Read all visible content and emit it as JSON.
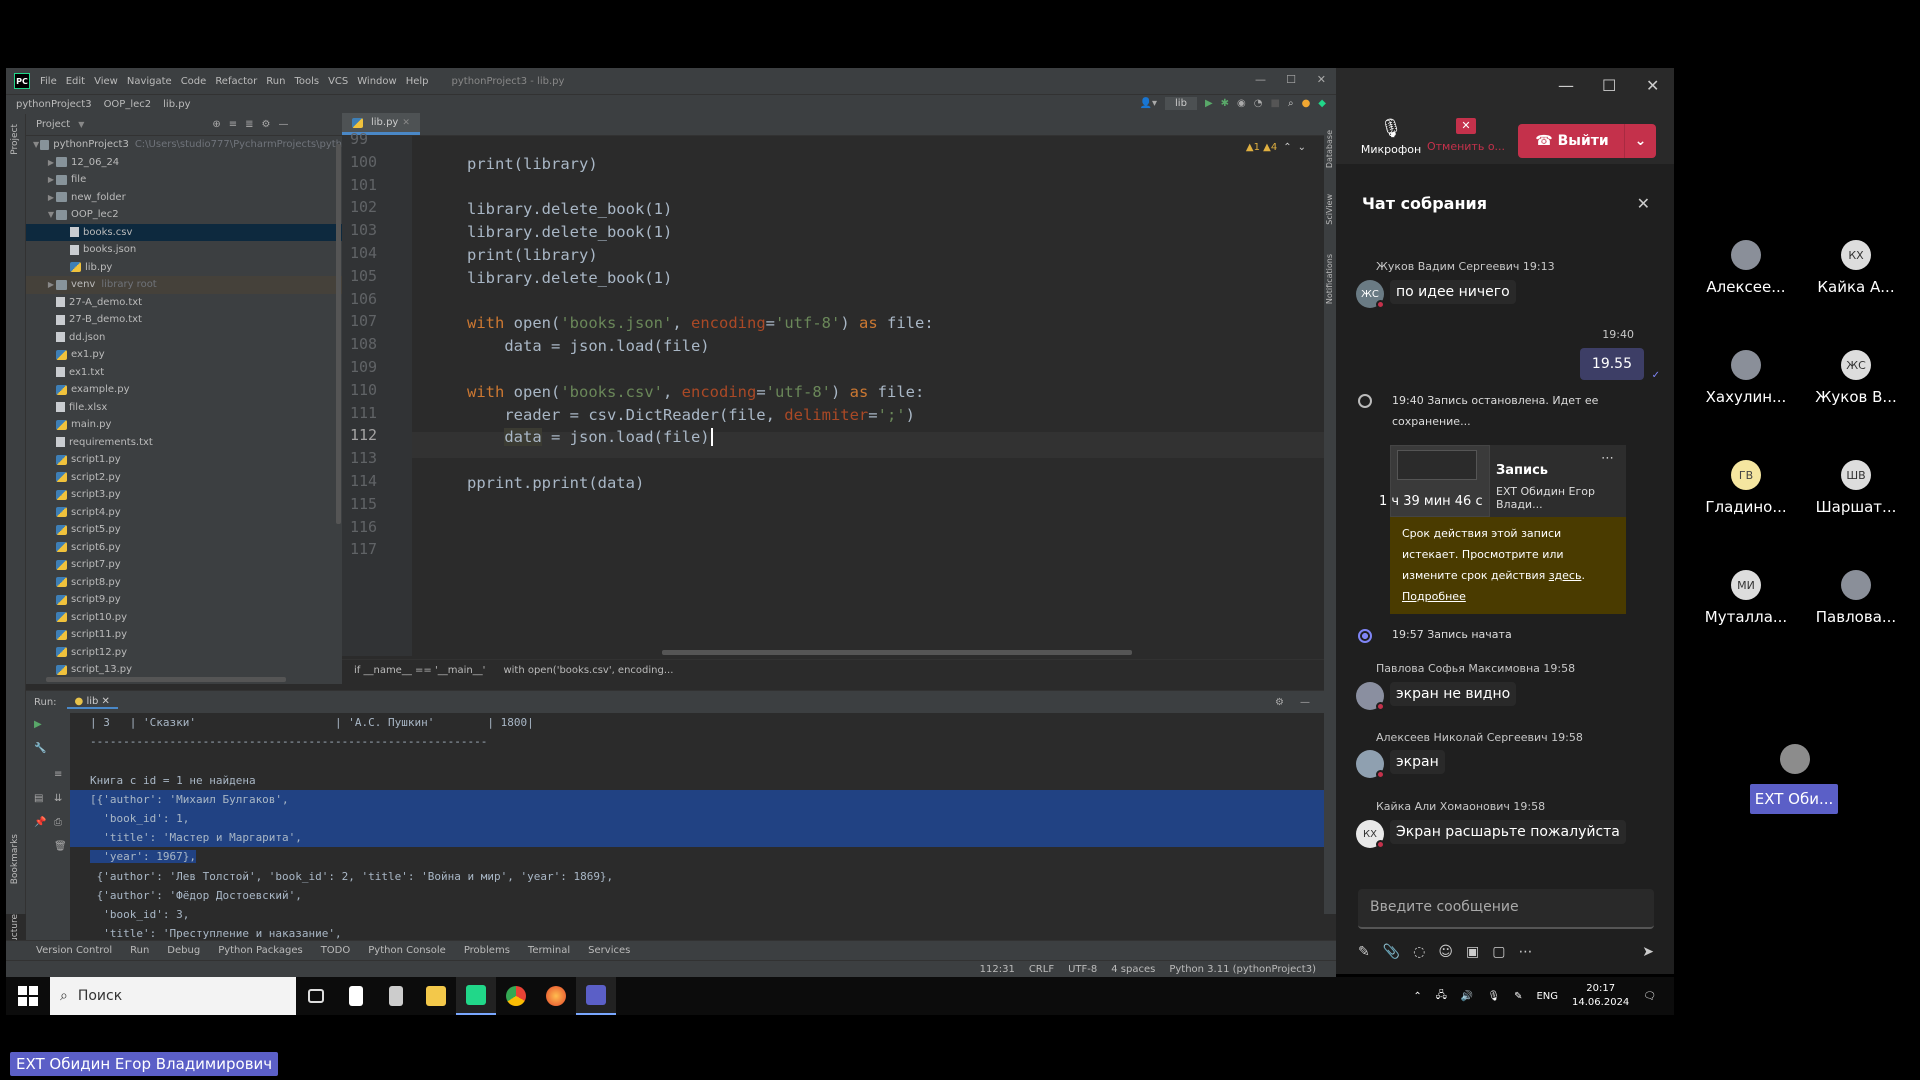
{
  "ide": {
    "logo": "PC",
    "menu": [
      "File",
      "Edit",
      "View",
      "Navigate",
      "Code",
      "Refactor",
      "Run",
      "Tools",
      "VCS",
      "Window",
      "Help"
    ],
    "window_title": "pythonProject3 - lib.py",
    "breadcrumbs": [
      "pythonProject3",
      "OOP_lec2",
      "lib.py"
    ],
    "run_config": "lib",
    "project_label": "Project",
    "tree": [
      {
        "name": "pythonProject3",
        "hint": "C:\\Users\\studio777\\PycharmProjects\\pyth",
        "type": "folder",
        "depth": 0,
        "open": true
      },
      {
        "name": "12_06_24",
        "type": "folder",
        "depth": 1
      },
      {
        "name": "file",
        "type": "folder",
        "depth": 1
      },
      {
        "name": "new_folder",
        "type": "folder",
        "depth": 1
      },
      {
        "name": "OOP_lec2",
        "type": "folder",
        "depth": 1,
        "open": true
      },
      {
        "name": "books.csv",
        "type": "txt",
        "depth": 2,
        "selected": true
      },
      {
        "name": "books.json",
        "type": "txt",
        "depth": 2
      },
      {
        "name": "lib.py",
        "type": "py",
        "depth": 2
      },
      {
        "name": "venv",
        "hint": "library root",
        "type": "folder",
        "depth": 1,
        "venv": true
      },
      {
        "name": "27-A_demo.txt",
        "type": "txt",
        "depth": 1
      },
      {
        "name": "27-B_demo.txt",
        "type": "txt",
        "depth": 1
      },
      {
        "name": "dd.json",
        "type": "txt",
        "depth": 1
      },
      {
        "name": "ex1.py",
        "type": "py",
        "depth": 1
      },
      {
        "name": "ex1.txt",
        "type": "txt",
        "depth": 1
      },
      {
        "name": "example.py",
        "type": "py",
        "depth": 1
      },
      {
        "name": "file.xlsx",
        "type": "txt",
        "depth": 1
      },
      {
        "name": "main.py",
        "type": "py",
        "depth": 1
      },
      {
        "name": "requirements.txt",
        "type": "txt",
        "depth": 1
      },
      {
        "name": "script1.py",
        "type": "py",
        "depth": 1
      },
      {
        "name": "script2.py",
        "type": "py",
        "depth": 1
      },
      {
        "name": "script3.py",
        "type": "py",
        "depth": 1
      },
      {
        "name": "script4.py",
        "type": "py",
        "depth": 1
      },
      {
        "name": "script5.py",
        "type": "py",
        "depth": 1
      },
      {
        "name": "script6.py",
        "type": "py",
        "depth": 1
      },
      {
        "name": "script7.py",
        "type": "py",
        "depth": 1
      },
      {
        "name": "script8.py",
        "type": "py",
        "depth": 1
      },
      {
        "name": "script9.py",
        "type": "py",
        "depth": 1
      },
      {
        "name": "script10.py",
        "type": "py",
        "depth": 1
      },
      {
        "name": "script11.py",
        "type": "py",
        "depth": 1
      },
      {
        "name": "script12.py",
        "type": "py",
        "depth": 1
      },
      {
        "name": "script_13.py",
        "type": "py",
        "depth": 1
      }
    ],
    "editor_tab": "lib.py",
    "warnings": "▲1  ▲4",
    "lines": [
      {
        "n": "99",
        "code": []
      },
      {
        "n": "100",
        "code": [
          [
            "t",
            "print(library)"
          ]
        ]
      },
      {
        "n": "101",
        "code": []
      },
      {
        "n": "102",
        "code": [
          [
            "t",
            "library.delete_book(1)"
          ]
        ]
      },
      {
        "n": "103",
        "code": [
          [
            "t",
            "library.delete_book(1)"
          ]
        ]
      },
      {
        "n": "104",
        "code": [
          [
            "t",
            "print(library)"
          ]
        ]
      },
      {
        "n": "105",
        "code": [
          [
            "t",
            "library.delete_book(1)"
          ]
        ]
      },
      {
        "n": "106",
        "code": []
      },
      {
        "n": "107",
        "code": [
          [
            "kw",
            "with "
          ],
          [
            "t",
            "open("
          ],
          [
            "str",
            "'books.json'"
          ],
          [
            "t",
            ", "
          ],
          [
            "prm",
            "encoding"
          ],
          [
            "t",
            "="
          ],
          [
            "str",
            "'utf-8'"
          ],
          [
            "t",
            ") "
          ],
          [
            "kw",
            "as "
          ],
          [
            "t",
            "file:"
          ]
        ]
      },
      {
        "n": "108",
        "code": [
          [
            "t",
            "    data = json.load(file)"
          ]
        ]
      },
      {
        "n": "109",
        "code": []
      },
      {
        "n": "110",
        "code": [
          [
            "kw",
            "with "
          ],
          [
            "t",
            "open("
          ],
          [
            "str",
            "'books.csv'"
          ],
          [
            "t",
            ", "
          ],
          [
            "prm",
            "encoding"
          ],
          [
            "t",
            "="
          ],
          [
            "str",
            "'utf-8'"
          ],
          [
            "t",
            ") "
          ],
          [
            "kw",
            "as "
          ],
          [
            "t",
            "file:"
          ]
        ]
      },
      {
        "n": "111",
        "code": [
          [
            "t",
            "    reader = csv.DictReader(file, "
          ],
          [
            "prm",
            "delimiter"
          ],
          [
            "t",
            "="
          ],
          [
            "str",
            "';'"
          ],
          [
            "t",
            ")"
          ]
        ]
      },
      {
        "n": "112",
        "code": [
          [
            "t",
            "    "
          ],
          [
            "hl",
            "data"
          ],
          [
            "t",
            " = json.load(file)"
          ]
        ],
        "current": true
      },
      {
        "n": "113",
        "code": []
      },
      {
        "n": "114",
        "code": [
          [
            "t",
            "pprint.pprint(data)"
          ]
        ]
      },
      {
        "n": "115",
        "code": []
      },
      {
        "n": "116",
        "code": []
      },
      {
        "n": "117",
        "code": []
      }
    ],
    "code_breadcrumb": [
      "if __name__ == '__main__'",
      "with open('books.csv', encoding..."
    ],
    "run_label": "Run:",
    "run_tab": "lib",
    "output": [
      {
        "text": "| 3   | 'Сказки'                     | 'А.С. Пушкин'        | 1800|"
      },
      {
        "text": "------------------------------------------------------------"
      },
      {
        "text": ""
      },
      {
        "text": "Книга с id = 1 не найдена"
      },
      {
        "text": "[{'author': 'Михаил Булгаков',",
        "sel": true
      },
      {
        "text": "  'book_id': 1,",
        "sel": true
      },
      {
        "text": "  'title': 'Мастер и Маргарита',",
        "sel": true
      },
      {
        "text": "  'year': 1967},",
        "sel": true,
        "partial": true
      },
      {
        "text": " {'author': 'Лев Толстой', 'book_id': 2, 'title': 'Война и мир', 'year': 1869},"
      },
      {
        "text": " {'author': 'Фёдор Достоевский',"
      },
      {
        "text": "  'book_id': 3,"
      },
      {
        "text": "  'title': 'Преступление и наказание',"
      }
    ],
    "tool_tabs": [
      "Version Control",
      "Run",
      "Debug",
      "Python Packages",
      "TODO",
      "Python Console",
      "Problems",
      "Terminal",
      "Services"
    ],
    "status": [
      "112:31",
      "CRLF",
      "UTF-8",
      "4 spaces",
      "Python 3.11 (pythonProject3)"
    ],
    "side_labels": {
      "project": "Project",
      "bookmarks": "Bookmarks",
      "structure": "Structure",
      "database": "Database",
      "sciview": "SciView",
      "notifications": "Notifications"
    }
  },
  "taskbar": {
    "search_placeholder": "Поиск",
    "lang": "ENG",
    "time": "20:17",
    "date": "14.06.2024"
  },
  "teams": {
    "mic_label": "Микрофон",
    "cancel_label": "Отменить о...",
    "leave_label": "Выйти",
    "chat_title": "Чат собрания",
    "messages": {
      "m1_meta": "Жуков Вадим Сергеевич  19:13",
      "m1_text": "по идее ничего",
      "m1_av": "ЖС",
      "my_time": "19:40",
      "my_text": "19.55",
      "sys1": "19:40   Запись остановлена. Идет ее сохранение...",
      "rec_title": "Запись",
      "rec_owner": "EXT Обидин Егор Влади...",
      "rec_duration": "1 ч 39 мин 46 с",
      "notice_text": "Срок действия этой записи истекает. Просмотрите или измените срок действия ",
      "notice_link": "здесь",
      "notice_more": "Подробнее",
      "sys2": "19:57   Запись начата",
      "m2_meta": "Павлова Софья Максимовна  19:58",
      "m2_text": "экран не видно",
      "m3_meta": "Алексеев Николай Сергеевич  19:58",
      "m3_text": "экран",
      "m4_meta": "Кайка Али Хомаонович  19:58",
      "m4_text": "Экран расшарьте пожалуйста",
      "m4_av": "КХ"
    },
    "input_placeholder": "Введите сообщение",
    "participants": [
      {
        "name": "Алексее...",
        "initials": "",
        "photo": true
      },
      {
        "name": "Кайка А...",
        "initials": "КХ"
      },
      {
        "name": "Хахулин...",
        "initials": "",
        "photo": true
      },
      {
        "name": "Жуков В...",
        "initials": "ЖС"
      },
      {
        "name": "Гладино...",
        "initials": "ГВ",
        "yellow": true
      },
      {
        "name": "Шаршат...",
        "initials": "ШВ"
      },
      {
        "name": "Муталла...",
        "initials": "МИ"
      },
      {
        "name": "Павлова...",
        "initials": "",
        "photo": true
      }
    ],
    "presenter_tile": "EXT Оби...",
    "presenter_caption": "EXT Обидин Егор Владимирович"
  },
  "colors": {
    "accent": "#5b5fc7",
    "leave": "#c4314b",
    "selection": "#214283"
  }
}
